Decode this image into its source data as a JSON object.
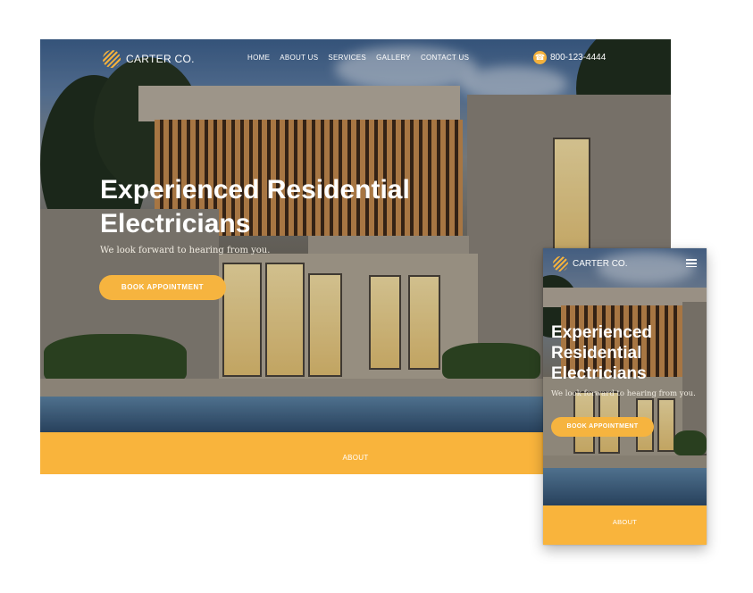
{
  "desktop": {
    "brand": "CARTER CO.",
    "nav": [
      "HOME",
      "ABOUT US",
      "SERVICES",
      "GALLERY",
      "CONTACT US"
    ],
    "phone": "800-123-4444",
    "hero_title": "Experienced Residential Electricians",
    "hero_subtitle": "We look forward to hearing from you.",
    "cta": "BOOK APPOINTMENT",
    "section_label": "ABOUT"
  },
  "mobile": {
    "brand": "CARTER CO.",
    "hero_title": "Experienced Residential Electricians",
    "hero_subtitle": "We look forward to hearing from you.",
    "cta": "BOOK APPOINTMENT",
    "section_label": "ABOUT"
  },
  "icons": [
    "carter-logo-icon",
    "phone-icon",
    "hamburger-menu-icon"
  ],
  "colors": {
    "accent": "#f6b43f",
    "band": "#f9b43c",
    "text": "#ffffff"
  }
}
